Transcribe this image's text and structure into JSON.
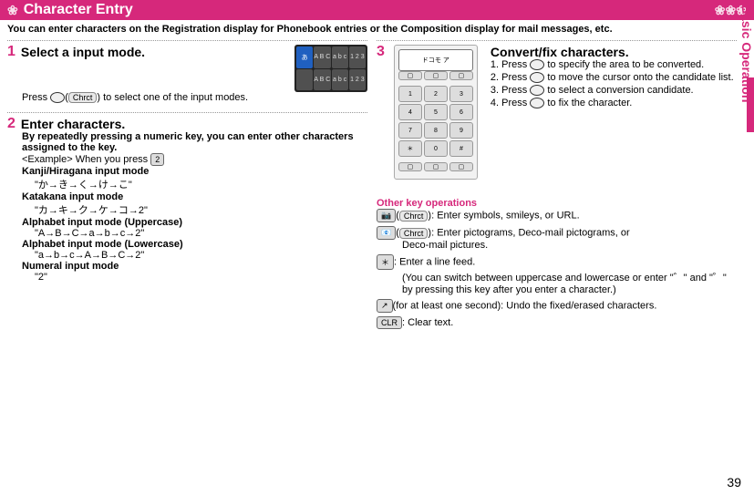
{
  "header": {
    "title": "Character Entry"
  },
  "intro": "You can enter characters on the Registration display for Phonebook entries or the Composition display for mail messages, etc.",
  "side_tab": "Basic Operation",
  "page_number": "39",
  "input_preview": {
    "cells": [
      "あ",
      "A B C",
      "a b c",
      "1 2 3",
      "",
      "A B C",
      "a b c",
      "1 2 3"
    ]
  },
  "step1": {
    "num": "1",
    "title": "Select a input mode.",
    "body_pre": "Press ",
    "nav_label": "Chrct",
    "body_post": " to select one of the input modes."
  },
  "step2": {
    "num": "2",
    "title": "Enter characters.",
    "lead": "By repeatedly pressing a numeric key, you can enter other characters assigned to the key.",
    "example_label": "<Example> When you press ",
    "example_key": "2",
    "modes": [
      {
        "name": "Kanji/Hiragana input mode",
        "seq": "\"か→き→く→け→こ\""
      },
      {
        "name": "Katakana input mode",
        "seq": "\"カ→キ→ク→ケ→コ→2\""
      },
      {
        "name": "Alphabet input mode (Uppercase)",
        "seq": "\"A→B→C→a→b→c→2\""
      },
      {
        "name": "Alphabet input mode (Lowercase)",
        "seq": "\"a→b→c→A→B→C→2\""
      },
      {
        "name": "Numeral input mode",
        "seq": "\"2\""
      }
    ]
  },
  "step3": {
    "num": "3",
    "title": "Convert/fix characters.",
    "items": [
      {
        "n": "1.",
        "pre": "Press ",
        "post": " to specify the area to be converted."
      },
      {
        "n": "2.",
        "pre": "Press ",
        "post": " to move the cursor onto the candidate list."
      },
      {
        "n": "3.",
        "pre": "Press ",
        "post": " to select a conversion candidate."
      },
      {
        "n": "4.",
        "pre": "Press ",
        "post": " to fix the character."
      }
    ]
  },
  "other": {
    "title": "Other key operations",
    "ops": [
      {
        "icon": "📷",
        "pill": "Chrct",
        "text": ": Enter symbols, smileys, or URL."
      },
      {
        "icon": "📧",
        "pill": "Chrct",
        "text": ": Enter pictograms, Deco-mail pictograms, or",
        "text2": "Deco-mail pictures."
      },
      {
        "icon": "＊",
        "text": ": Enter a line feed.",
        "note": "(You can switch between uppercase and lowercase or enter \"゛\" and \"゜\" by pressing this key after you enter a character.)"
      },
      {
        "icon": "↗",
        "text": "(for at least one second): Undo the fixed/erased characters."
      },
      {
        "icon": "CLR",
        "text": ": Clear text."
      }
    ]
  }
}
